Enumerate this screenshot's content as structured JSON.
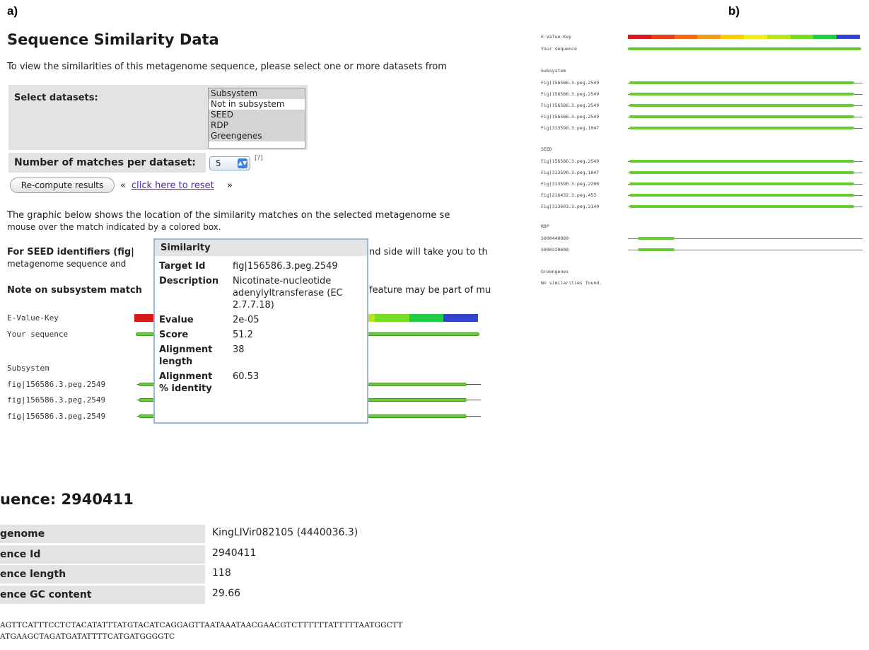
{
  "labels": {
    "a": "a)",
    "b": "b)"
  },
  "left": {
    "title": "Sequence Similarity Data",
    "intro": "To view the similarities of this metagenome sequence, please select one or more datasets from",
    "select_label": "Select datasets:",
    "datasets": [
      {
        "label": "Subsystem",
        "selected": true
      },
      {
        "label": "Not in subsystem",
        "selected": false
      },
      {
        "label": "SEED",
        "selected": true
      },
      {
        "label": "RDP",
        "selected": true
      },
      {
        "label": "Greengenes",
        "selected": true
      }
    ],
    "matches_label": "Number of matches per dataset:",
    "matches_value": "5",
    "help": "[?]",
    "recompute": "Re-compute results",
    "reset_prefix": "«",
    "reset_link": "click here to reset",
    "reset_suffix": "»",
    "graphic_text_1": "The graphic below shows the location of the similarity matches on the selected metagenome se",
    "graphic_text_2": "mouse over the match indicated by a colored box.",
    "seed_note_bold": "For SEED identifiers (fig|",
    "seed_note_rest": "nd side will take you to th",
    "seed_note_2": "metagenome sequence and",
    "subsystem_note_bold": "Note on subsystem match",
    "subsystem_note_rest": "feature may be part of mu",
    "evalue_key": "E-Value-Key",
    "your_sequence": "Your sequence",
    "subsystem_heading": "Subsystem",
    "subsystem_rows": [
      "fig|156586.3.peg.2549",
      "fig|156586.3.peg.2549",
      "fig|156586.3.peg.2549"
    ]
  },
  "tooltip": {
    "title": "Similarity",
    "rows": [
      {
        "key": "Target Id",
        "value": "fig|156586.3.peg.2549"
      },
      {
        "key": "Description",
        "value": "Nicotinate-nucleotide adenylyltransferase (EC 2.7.7.18)"
      },
      {
        "key": "Evalue",
        "value": "2e-05"
      },
      {
        "key": "Score",
        "value": "51.2"
      },
      {
        "key": "Alignment length",
        "value": "38"
      },
      {
        "key": "Alignment % identity",
        "value": "60.53"
      }
    ]
  },
  "sequence": {
    "title": "uence: 2940411",
    "meta": [
      {
        "key": "genome",
        "value": "KingLIVir082105 (4440036.3)"
      },
      {
        "key": "ence Id",
        "value": "2940411"
      },
      {
        "key": "ence length",
        "value": "118"
      },
      {
        "key": "ence GC content",
        "value": "29.66"
      }
    ],
    "line1": "AGTTCATTTCCTCTACATATTTATGTACATCAGGAGTTAATAAATAACGAACGTCTTTTTTATTTTTAATGGCTT",
    "line2": "ATGAAGCTAGATGATATTTTCATGATGGGGTC"
  },
  "right": {
    "evalue_key": "E-Value-Key",
    "your_sequence": "Your sequence",
    "subsystem_heading": "Subsystem",
    "subsystem_rows": [
      "Fig|156586.3.peg.2549",
      "Fig|156586.3.peg.2549",
      "Fig|156586.3.peg.2549",
      "Fig|156586.3.peg.2549",
      "Fig|313590.3.peg.1047"
    ],
    "seed_heading": "SEED",
    "seed_rows": [
      "Fig|156586.3.peg.2549",
      "Fig|313590.3.peg.1047",
      "Fig|313590.3.peg.2200",
      "Fig|216432.3.peg.453",
      "Fig|313603.3.peg.2140"
    ],
    "rdp_heading": "RDP",
    "rdp_rows": [
      "S000440089",
      "S000320698"
    ],
    "greengenes_heading": "Greengenes",
    "greengenes_note": "No similarities found."
  },
  "colors": {
    "evalue_key": [
      "#d7191c",
      "#e8401a",
      "#f06a1a",
      "#f59a1c",
      "#ffcc00",
      "#f2ee1e",
      "#b7e61c",
      "#77dd22",
      "#22cc44",
      "#3344cc"
    ]
  }
}
